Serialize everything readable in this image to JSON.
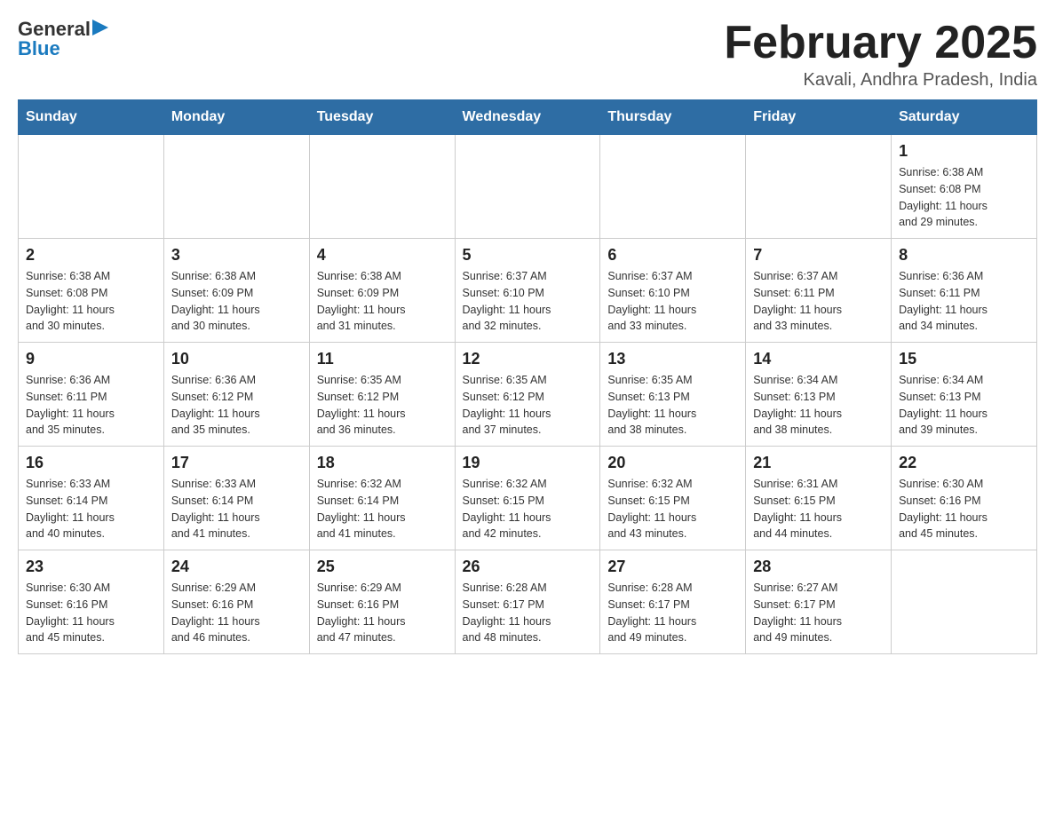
{
  "header": {
    "logo": {
      "general": "General",
      "blue": "Blue",
      "arrow": "▶"
    },
    "title": "February 2025",
    "location": "Kavali, Andhra Pradesh, India"
  },
  "days_of_week": [
    "Sunday",
    "Monday",
    "Tuesday",
    "Wednesday",
    "Thursday",
    "Friday",
    "Saturday"
  ],
  "weeks": [
    [
      {
        "day": "",
        "info": ""
      },
      {
        "day": "",
        "info": ""
      },
      {
        "day": "",
        "info": ""
      },
      {
        "day": "",
        "info": ""
      },
      {
        "day": "",
        "info": ""
      },
      {
        "day": "",
        "info": ""
      },
      {
        "day": "1",
        "info": "Sunrise: 6:38 AM\nSunset: 6:08 PM\nDaylight: 11 hours\nand 29 minutes."
      }
    ],
    [
      {
        "day": "2",
        "info": "Sunrise: 6:38 AM\nSunset: 6:08 PM\nDaylight: 11 hours\nand 30 minutes."
      },
      {
        "day": "3",
        "info": "Sunrise: 6:38 AM\nSunset: 6:09 PM\nDaylight: 11 hours\nand 30 minutes."
      },
      {
        "day": "4",
        "info": "Sunrise: 6:38 AM\nSunset: 6:09 PM\nDaylight: 11 hours\nand 31 minutes."
      },
      {
        "day": "5",
        "info": "Sunrise: 6:37 AM\nSunset: 6:10 PM\nDaylight: 11 hours\nand 32 minutes."
      },
      {
        "day": "6",
        "info": "Sunrise: 6:37 AM\nSunset: 6:10 PM\nDaylight: 11 hours\nand 33 minutes."
      },
      {
        "day": "7",
        "info": "Sunrise: 6:37 AM\nSunset: 6:11 PM\nDaylight: 11 hours\nand 33 minutes."
      },
      {
        "day": "8",
        "info": "Sunrise: 6:36 AM\nSunset: 6:11 PM\nDaylight: 11 hours\nand 34 minutes."
      }
    ],
    [
      {
        "day": "9",
        "info": "Sunrise: 6:36 AM\nSunset: 6:11 PM\nDaylight: 11 hours\nand 35 minutes."
      },
      {
        "day": "10",
        "info": "Sunrise: 6:36 AM\nSunset: 6:12 PM\nDaylight: 11 hours\nand 35 minutes."
      },
      {
        "day": "11",
        "info": "Sunrise: 6:35 AM\nSunset: 6:12 PM\nDaylight: 11 hours\nand 36 minutes."
      },
      {
        "day": "12",
        "info": "Sunrise: 6:35 AM\nSunset: 6:12 PM\nDaylight: 11 hours\nand 37 minutes."
      },
      {
        "day": "13",
        "info": "Sunrise: 6:35 AM\nSunset: 6:13 PM\nDaylight: 11 hours\nand 38 minutes."
      },
      {
        "day": "14",
        "info": "Sunrise: 6:34 AM\nSunset: 6:13 PM\nDaylight: 11 hours\nand 38 minutes."
      },
      {
        "day": "15",
        "info": "Sunrise: 6:34 AM\nSunset: 6:13 PM\nDaylight: 11 hours\nand 39 minutes."
      }
    ],
    [
      {
        "day": "16",
        "info": "Sunrise: 6:33 AM\nSunset: 6:14 PM\nDaylight: 11 hours\nand 40 minutes."
      },
      {
        "day": "17",
        "info": "Sunrise: 6:33 AM\nSunset: 6:14 PM\nDaylight: 11 hours\nand 41 minutes."
      },
      {
        "day": "18",
        "info": "Sunrise: 6:32 AM\nSunset: 6:14 PM\nDaylight: 11 hours\nand 41 minutes."
      },
      {
        "day": "19",
        "info": "Sunrise: 6:32 AM\nSunset: 6:15 PM\nDaylight: 11 hours\nand 42 minutes."
      },
      {
        "day": "20",
        "info": "Sunrise: 6:32 AM\nSunset: 6:15 PM\nDaylight: 11 hours\nand 43 minutes."
      },
      {
        "day": "21",
        "info": "Sunrise: 6:31 AM\nSunset: 6:15 PM\nDaylight: 11 hours\nand 44 minutes."
      },
      {
        "day": "22",
        "info": "Sunrise: 6:30 AM\nSunset: 6:16 PM\nDaylight: 11 hours\nand 45 minutes."
      }
    ],
    [
      {
        "day": "23",
        "info": "Sunrise: 6:30 AM\nSunset: 6:16 PM\nDaylight: 11 hours\nand 45 minutes."
      },
      {
        "day": "24",
        "info": "Sunrise: 6:29 AM\nSunset: 6:16 PM\nDaylight: 11 hours\nand 46 minutes."
      },
      {
        "day": "25",
        "info": "Sunrise: 6:29 AM\nSunset: 6:16 PM\nDaylight: 11 hours\nand 47 minutes."
      },
      {
        "day": "26",
        "info": "Sunrise: 6:28 AM\nSunset: 6:17 PM\nDaylight: 11 hours\nand 48 minutes."
      },
      {
        "day": "27",
        "info": "Sunrise: 6:28 AM\nSunset: 6:17 PM\nDaylight: 11 hours\nand 49 minutes."
      },
      {
        "day": "28",
        "info": "Sunrise: 6:27 AM\nSunset: 6:17 PM\nDaylight: 11 hours\nand 49 minutes."
      },
      {
        "day": "",
        "info": ""
      }
    ]
  ]
}
